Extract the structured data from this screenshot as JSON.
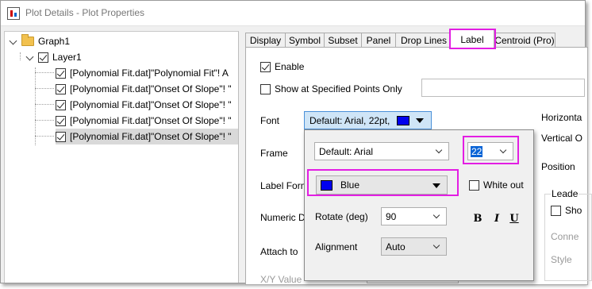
{
  "window": {
    "title": "Plot Details - Plot Properties"
  },
  "tree": {
    "root": {
      "label": "Graph1"
    },
    "layer": {
      "label": "Layer1"
    },
    "items": [
      {
        "label": "[Polynomial Fit.dat]\"Polynomial Fit\"! A"
      },
      {
        "label": "[Polynomial Fit.dat]\"Onset Of Slope\"! \""
      },
      {
        "label": "[Polynomial Fit.dat]\"Onset Of Slope\"! \""
      },
      {
        "label": "[Polynomial Fit.dat]\"Onset Of Slope\"! \""
      },
      {
        "label": "[Polynomial Fit.dat]\"Onset Of Slope\"! \""
      }
    ]
  },
  "tabs": [
    "Display",
    "Symbol",
    "Subset",
    "Panel",
    "Drop Lines",
    "Label",
    "Centroid (Pro)"
  ],
  "active_tab": "Label",
  "panel": {
    "enable_label": "Enable",
    "show_at_points_label": "Show at Specified Points Only",
    "font_label": "Font",
    "font_value": "Default: Arial, 22pt,",
    "frame_label": "Frame",
    "label_form_label": "Label Form",
    "numeric_label": "Numeric D",
    "attach_label": "Attach to",
    "xy_value_label": "X/Y Value",
    "horizontal_label": "Horizonta",
    "vertical_label": "Vertical O",
    "position_label": "Position",
    "leader_label": "Leade",
    "show_label": "Sho",
    "connect_label": "Conne",
    "style_label": "Style"
  },
  "font_popup": {
    "font_name": "Default: Arial",
    "font_size": "22",
    "color_name": "Blue",
    "white_out_label": "White out",
    "rotate_label": "Rotate (deg)",
    "rotate_value": "90",
    "alignment_label": "Alignment",
    "alignment_value": "Auto",
    "bold_glyph": "B",
    "italic_glyph": "I",
    "underline_glyph": "U"
  },
  "colors": {
    "label_color": "#0000ee",
    "highlight": "#e31ee3",
    "selection": "#0a64d6"
  }
}
